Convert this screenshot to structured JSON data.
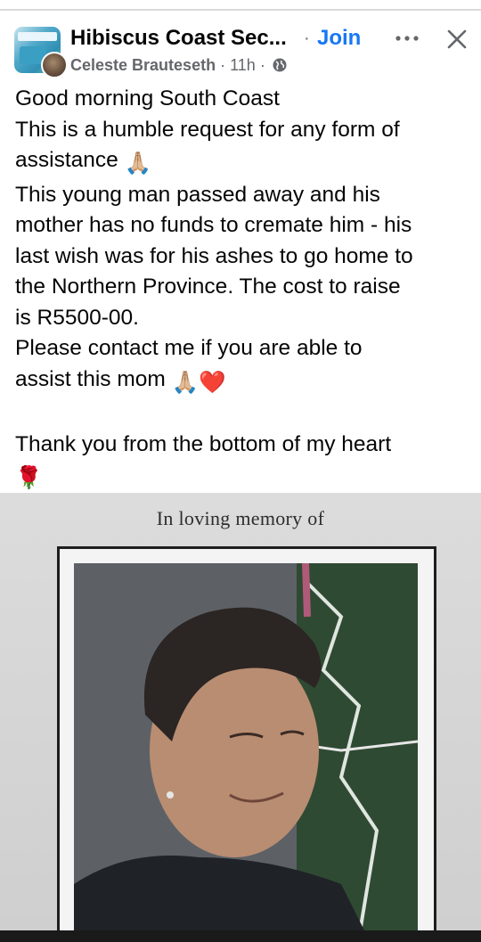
{
  "header": {
    "group_name": "Hibiscus Coast Sec...",
    "separator": "·",
    "join_label": "Join",
    "author": "Celeste Brauteseth",
    "time": "11h",
    "audience_icon": "globe-icon",
    "more_icon": "more-horizontal-icon",
    "close_icon": "close-icon"
  },
  "post": {
    "lines": [
      "Good morning South Coast",
      "This is a humble request for any form of",
      "assistance",
      "This young man passed away and his",
      "mother has no funds to cremate him - his",
      "last wish was for his ashes to go home to",
      "the Northern Province. The cost to raise",
      "is R5500-00.",
      "Please contact me if you are able to",
      "assist this mom",
      "",
      "Thank you from the bottom of my heart"
    ],
    "emojis": {
      "assistance": "🙏🏼",
      "assist_this_mom": "🙏🏼❤️",
      "thank_you": "🌹"
    }
  },
  "photo": {
    "heading": "In loving memory of"
  },
  "colors": {
    "link": "#1877f2",
    "text": "#050505",
    "secondary": "#65676b"
  }
}
